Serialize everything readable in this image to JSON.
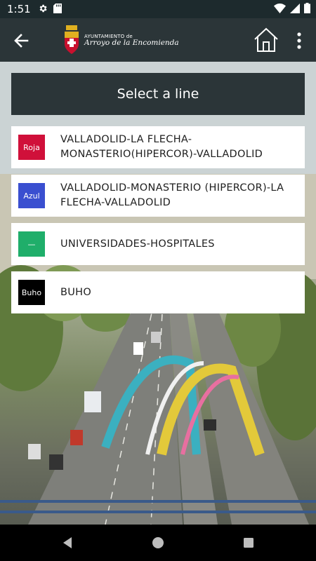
{
  "status_bar": {
    "time": "1:51",
    "left_icons": [
      "gear-icon",
      "sd-card-icon"
    ],
    "right_icons": [
      "wifi-icon",
      "signal-icon",
      "battery-icon"
    ]
  },
  "app_bar": {
    "back_icon": "arrow-back-icon",
    "logo_line1": "AYUNTAMIENTO de",
    "logo_line2": "Arroyo de la Encomienda",
    "home_icon": "home-icon",
    "menu_icon": "more-vert-icon",
    "background_color": "#2b3538"
  },
  "header": {
    "title": "Select a line"
  },
  "lines": [
    {
      "badge": "Roja",
      "color": "#d0103a",
      "name": "VALLADOLID-LA FLECHA-MONASTERIO(HIPERCOR)-VALLADOLID"
    },
    {
      "badge": "Azul",
      "color": "#3a4fd0",
      "name": "VALLADOLID-MONASTERIO (HIPERCOR)-LA FLECHA-VALLADOLID"
    },
    {
      "badge": "—",
      "color": "#1fae6a",
      "name": "UNIVERSIDADES-HOSPITALES"
    },
    {
      "badge": "Buho",
      "color": "#000000",
      "name": "BUHO"
    }
  ],
  "nav_bar": {
    "icons": [
      "back-triangle-icon",
      "home-circle-icon",
      "recents-square-icon"
    ]
  }
}
